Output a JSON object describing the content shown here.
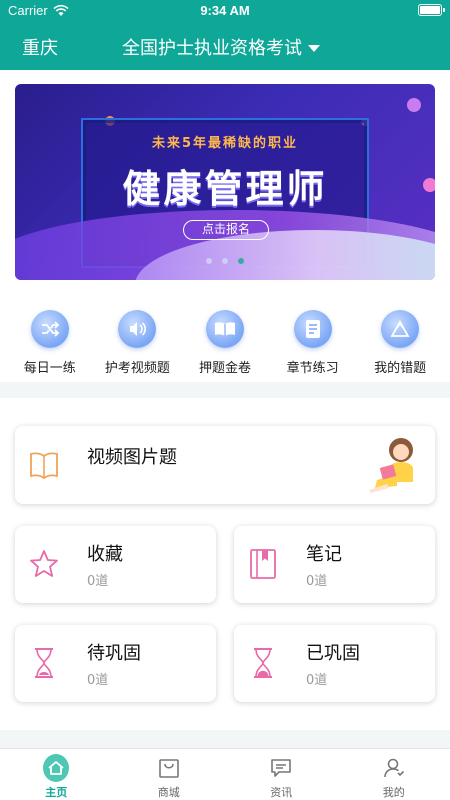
{
  "status_bar": {
    "carrier": "Carrier",
    "time": "9:34 AM"
  },
  "header": {
    "city": "重庆",
    "exam": "全国护士执业资格考试"
  },
  "banner": {
    "subtitle": "未来5年最稀缺的职业",
    "title": "健康管理师",
    "button": "点击报名",
    "slides": 3,
    "active_slide": 3
  },
  "quick_links": [
    {
      "label": "每日一练",
      "icon": "shuffle-icon"
    },
    {
      "label": "护考视频题",
      "icon": "speaker-icon"
    },
    {
      "label": "押题金卷",
      "icon": "open-book-icon"
    },
    {
      "label": "章节练习",
      "icon": "document-icon"
    },
    {
      "label": "我的错题",
      "icon": "recycle-triangle-icon"
    }
  ],
  "cards": {
    "video": {
      "title": "视频图片题",
      "icon": "book-icon"
    },
    "favorites": {
      "title": "收藏",
      "count": "0道",
      "icon": "star-icon"
    },
    "notes": {
      "title": "笔记",
      "count": "0道",
      "icon": "notebook-icon"
    },
    "to_consolidate": {
      "title": "待巩固",
      "count": "0道",
      "icon": "hourglass-icon"
    },
    "consolidated": {
      "title": "已巩固",
      "count": "0道",
      "icon": "hourglass-full-icon"
    }
  },
  "tabbar": [
    {
      "label": "主页",
      "icon": "home-icon",
      "active": true
    },
    {
      "label": "商城",
      "icon": "shop-bag-icon",
      "active": false
    },
    {
      "label": "资讯",
      "icon": "chat-icon",
      "active": false
    },
    {
      "label": "我的",
      "icon": "user-icon",
      "active": false
    }
  ],
  "colors": {
    "primary": "#0fa898",
    "accent_pink": "#e96aa8",
    "accent_orange": "#f0a35a",
    "count_gray": "#9a9a9a"
  }
}
